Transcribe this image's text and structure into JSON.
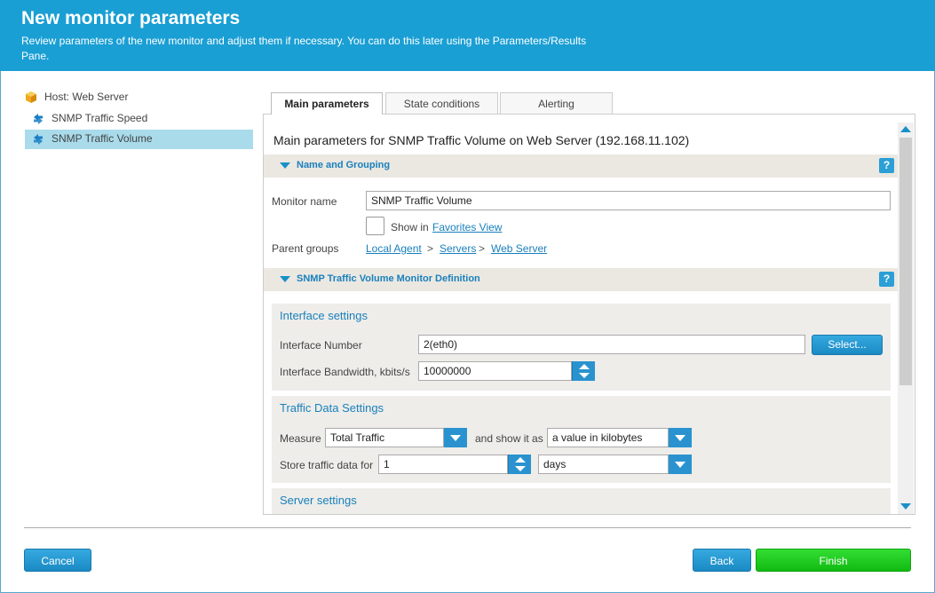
{
  "header": {
    "title": "New monitor parameters",
    "subtitle": "Review parameters of the new monitor and adjust them if necessary. You can do this later using the Parameters/Results Pane."
  },
  "tree": {
    "host_label": "Host: Web Server",
    "items": [
      {
        "label": "SNMP Traffic Speed",
        "selected": false
      },
      {
        "label": "SNMP Traffic Volume",
        "selected": true
      }
    ]
  },
  "tabs": [
    {
      "label": "Main parameters",
      "active": true
    },
    {
      "label": "State conditions",
      "active": false
    },
    {
      "label": "Alerting",
      "active": false
    }
  ],
  "panel": {
    "title": "Main parameters for SNMP Traffic Volume on Web Server (192.168.11.102)",
    "name_section": {
      "title": "Name and Grouping",
      "help": "?",
      "monitor_name_label": "Monitor name",
      "monitor_name_value": "SNMP Traffic Volume",
      "show_in_label": "Show in",
      "favorites_link": "Favorites View",
      "parent_groups_label": "Parent groups",
      "parent_groups": [
        "Local Agent",
        "Servers",
        "Web Server"
      ],
      "separator": ">"
    },
    "definition_section": {
      "title": "SNMP Traffic Volume Monitor Definition",
      "help": "?",
      "interface": {
        "title": "Interface settings",
        "number_label": "Interface Number",
        "number_value": "2(eth0)",
        "select_button": "Select...",
        "bandwidth_label": "Interface Bandwidth, kbits/s",
        "bandwidth_value": "10000000"
      },
      "traffic": {
        "title": "Traffic Data Settings",
        "measure_label": "Measure",
        "measure_value": "Total Traffic",
        "show_as_label": "and show it as",
        "show_as_value": "a value in kilobytes",
        "store_label": "Store traffic data for",
        "store_value": "1",
        "store_unit": "days"
      },
      "server": {
        "title": "Server settings"
      }
    }
  },
  "footer": {
    "cancel": "Cancel",
    "back": "Back",
    "finish": "Finish"
  },
  "colors": {
    "header_bg": "#1a9fd4",
    "accent_blue": "#2a93cf",
    "finish_green": "#22cc22",
    "selected_row": "#a9dbeb"
  }
}
